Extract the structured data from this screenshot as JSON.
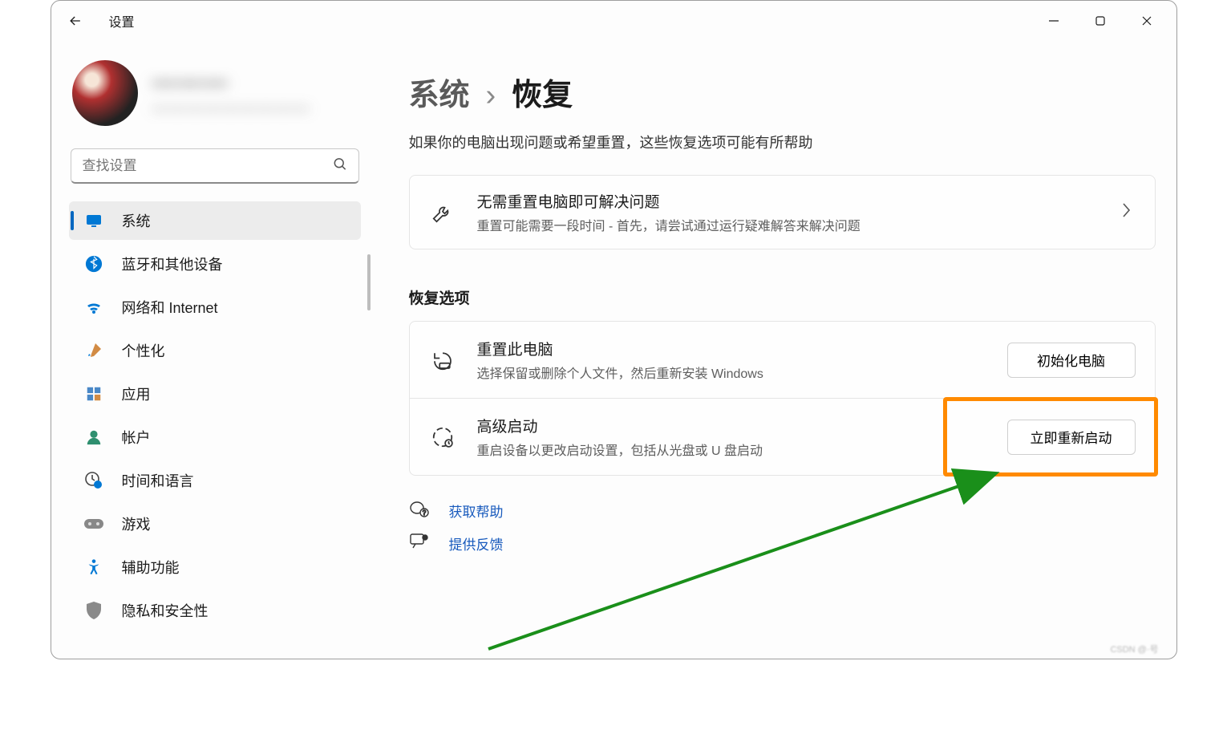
{
  "app": {
    "title": "设置"
  },
  "search": {
    "placeholder": "查找设置"
  },
  "profile": {
    "name_blur": "———",
    "sub_blur": "—————————"
  },
  "sidebar": {
    "items": [
      {
        "id": "system",
        "label": "系统",
        "icon": "monitor-icon",
        "active": true
      },
      {
        "id": "bluetooth",
        "label": "蓝牙和其他设备",
        "icon": "bluetooth-icon",
        "active": false
      },
      {
        "id": "network",
        "label": "网络和 Internet",
        "icon": "wifi-icon",
        "active": false
      },
      {
        "id": "personalize",
        "label": "个性化",
        "icon": "paintbrush-icon",
        "active": false
      },
      {
        "id": "apps",
        "label": "应用",
        "icon": "apps-icon",
        "active": false
      },
      {
        "id": "accounts",
        "label": "帐户",
        "icon": "person-icon",
        "active": false
      },
      {
        "id": "timelang",
        "label": "时间和语言",
        "icon": "clock-globe-icon",
        "active": false
      },
      {
        "id": "gaming",
        "label": "游戏",
        "icon": "gamepad-icon",
        "active": false
      },
      {
        "id": "accessibility",
        "label": "辅助功能",
        "icon": "accessibility-icon",
        "active": false
      },
      {
        "id": "privacy",
        "label": "隐私和安全性",
        "icon": "shield-icon",
        "active": false
      }
    ]
  },
  "breadcrumb": {
    "root": "系统",
    "sep": "›",
    "leaf": "恢复"
  },
  "intro": "如果你的电脑出现问题或希望重置，这些恢复选项可能有所帮助",
  "troubleshoot_card": {
    "title": "无需重置电脑即可解决问题",
    "desc": "重置可能需要一段时间 - 首先，请尝试通过运行疑难解答来解决问题"
  },
  "recovery_section_title": "恢复选项",
  "recovery_options": [
    {
      "id": "reset",
      "title": "重置此电脑",
      "desc": "选择保留或删除个人文件，然后重新安装 Windows",
      "button": "初始化电脑",
      "icon": "reset-icon",
      "highlight": false
    },
    {
      "id": "advanced",
      "title": "高级启动",
      "desc": "重启设备以更改启动设置，包括从光盘或 U 盘启动",
      "button": "立即重新启动",
      "icon": "startup-icon",
      "highlight": true
    }
  ],
  "links": {
    "help": "获取帮助",
    "feedback": "提供反馈"
  },
  "watermark": "CSDN @·号"
}
